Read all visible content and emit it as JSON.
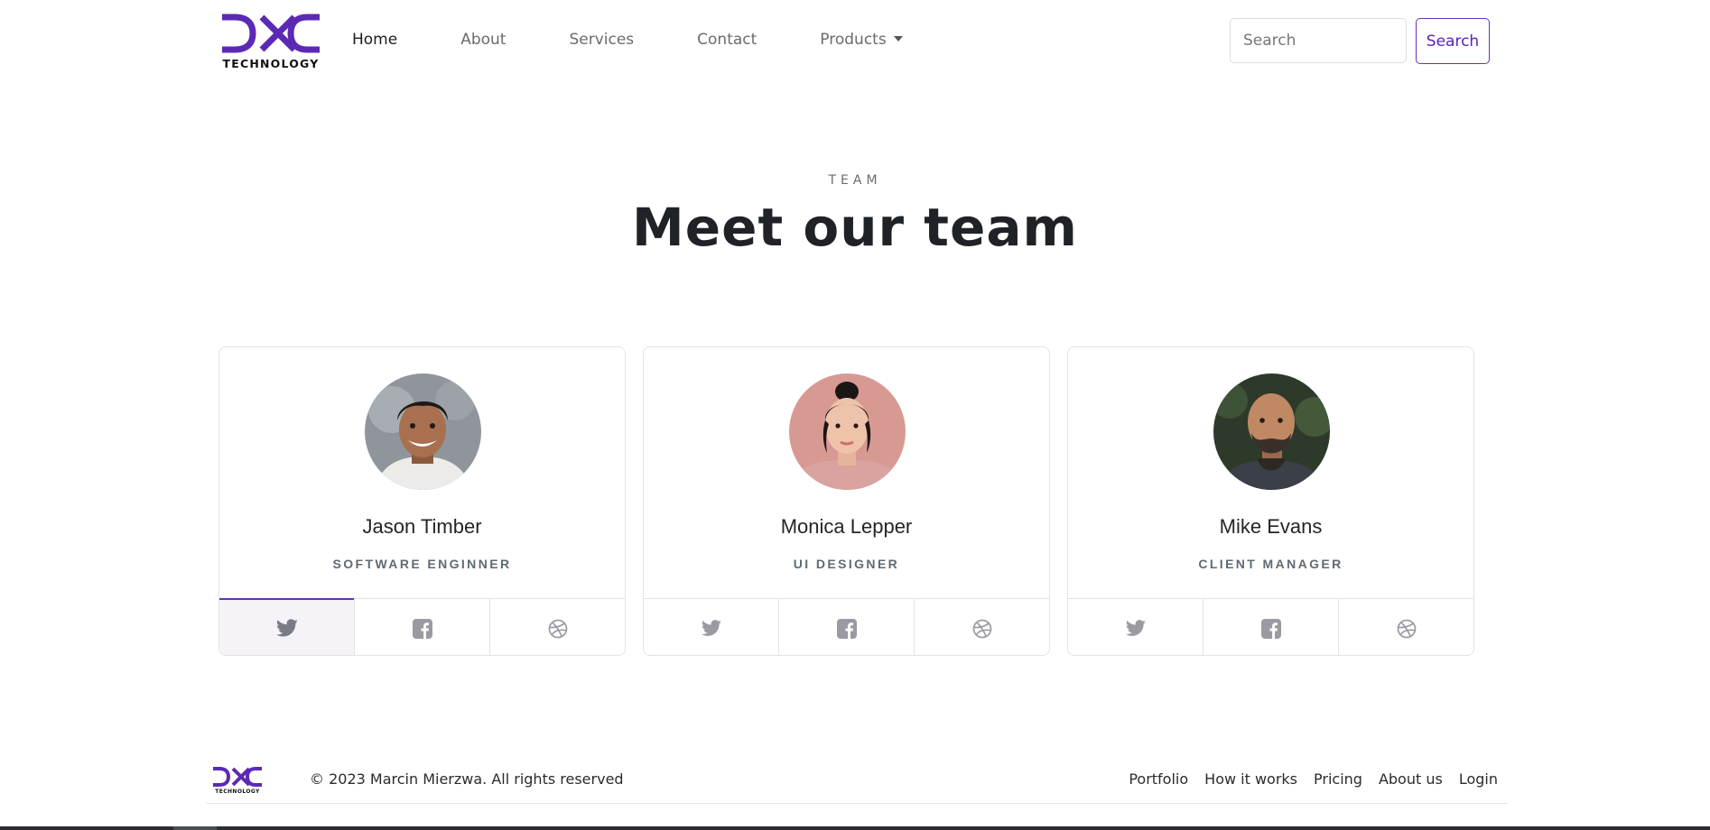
{
  "brand": {
    "name": "DXC",
    "word": "TECHNOLOGY",
    "color": "#5b2ab5"
  },
  "nav": {
    "items": [
      {
        "label": "Home",
        "active": true
      },
      {
        "label": "About"
      },
      {
        "label": "Services"
      },
      {
        "label": "Contact"
      },
      {
        "label": "Products",
        "dropdown": true
      }
    ],
    "search_placeholder": "Search",
    "search_button": "Search"
  },
  "team": {
    "eyebrow": "TEAM",
    "heading": "Meet our team",
    "members": [
      {
        "name": "Jason Timber",
        "role": "SOFTWARE ENGINNER",
        "socials": [
          "twitter-icon",
          "facebook-icon",
          "dribbble-icon"
        ],
        "active_social": 0
      },
      {
        "name": "Monica Lepper",
        "role": "UI DESIGNER",
        "socials": [
          "twitter-icon",
          "facebook-icon",
          "dribbble-icon"
        ]
      },
      {
        "name": "Mike Evans",
        "role": "CLIENT MANAGER",
        "socials": [
          "twitter-icon",
          "facebook-icon",
          "dribbble-icon"
        ]
      }
    ]
  },
  "footer": {
    "copyright": "© 2023 Marcin Mierzwa. All rights reserved",
    "links": [
      "Portfolio",
      "How it works",
      "Pricing",
      "About us",
      "Login"
    ]
  },
  "colors": {
    "accent": "#6a2fc0",
    "icon": "#9a9aa2",
    "active_icon": "#7b7b85"
  }
}
